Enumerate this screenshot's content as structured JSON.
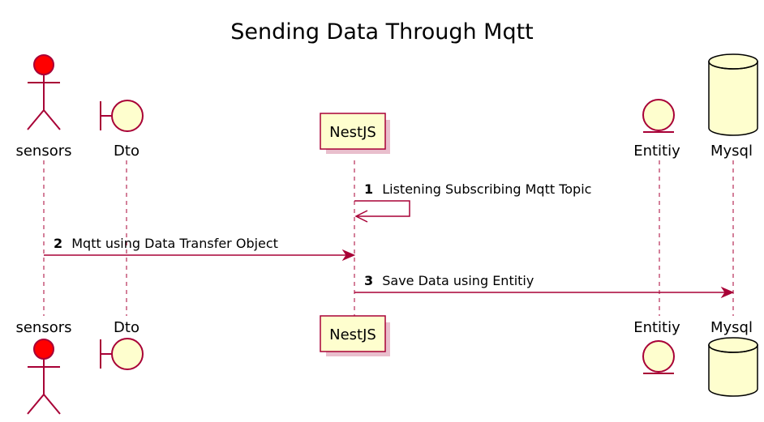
{
  "title": "Sending Data Through Mqtt",
  "colors": {
    "border": "#A80036",
    "fill": "#FEFECE",
    "actor_head": "#FF0000",
    "text": "#000000"
  },
  "participants": [
    {
      "id": "sensors",
      "label": "sensors",
      "kind": "actor"
    },
    {
      "id": "dto",
      "label": "Dto",
      "kind": "boundary"
    },
    {
      "id": "nestjs",
      "label": "NestJS",
      "kind": "participant"
    },
    {
      "id": "entitiy",
      "label": "Entitiy",
      "kind": "entity"
    },
    {
      "id": "mysql",
      "label": "Mysql",
      "kind": "database"
    }
  ],
  "messages": [
    {
      "number": "1",
      "text": "Listening Subscribing Mqtt Topic",
      "from": "NestJS",
      "to": "NestJS"
    },
    {
      "number": "2",
      "text": "Mqtt using Data Transfer Object",
      "from": "sensors",
      "to": "NestJS"
    },
    {
      "number": "3",
      "text": "Save Data using Entitiy",
      "from": "NestJS",
      "to": "Mysql"
    }
  ]
}
